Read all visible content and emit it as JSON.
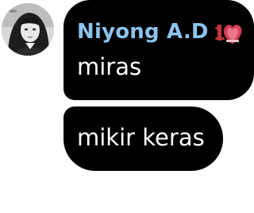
{
  "chat": {
    "avatar_icon": "user-avatar-photo",
    "sender": {
      "name": "Niyong A.D",
      "name_color": "#8cc4ee",
      "badge_icon": "fan-heart-badge-icon",
      "badge_number": "1"
    },
    "messages": [
      {
        "text": "miras"
      },
      {
        "text": "mikir keras"
      }
    ],
    "bubble_color": "#000000",
    "text_color": "#ffffff"
  }
}
